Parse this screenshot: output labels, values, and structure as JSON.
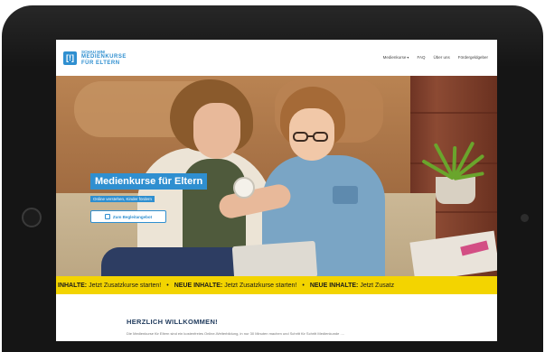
{
  "logo": {
    "badge": "[!]",
    "line1": "SCHAU HIN!",
    "line2": "MEDIENKURSE",
    "line3": "FÜR ELTERN"
  },
  "nav": {
    "items": [
      {
        "label": "Medienkurse",
        "has_caret": true
      },
      {
        "label": "FAQ"
      },
      {
        "label": "Über uns"
      },
      {
        "label": "Fördergeldgeber"
      }
    ]
  },
  "hero": {
    "title": "Medienkurse für Eltern",
    "subtitle": "Online verstehen, Kinder fördern",
    "button_label": "Zum Begleitangebot"
  },
  "ticker": {
    "items": [
      {
        "prefix": "INHALTE:",
        "text": "Jetzt Zusatzkurse starten!"
      },
      {
        "prefix": "NEUE INHALTE:",
        "text": "Jetzt Zusatzkurse starten!"
      },
      {
        "prefix": "NEUE INHALTE:",
        "text": "Jetzt Zusatz"
      }
    ],
    "separator": "•",
    "color": "#f3d400"
  },
  "welcome": {
    "title": "HERZLICH WILLKOMMEN!",
    "text": "Die Medienkurse für Eltern sind ein kostenfreies Online-Weiterbildung, in nur 30 Minuten machen und Schritt für Schritt Medienkunde ...."
  },
  "colors": {
    "brand_blue": "#2f8fd0",
    "ticker_yellow": "#f3d400",
    "heading_navy": "#1f3a5c"
  }
}
